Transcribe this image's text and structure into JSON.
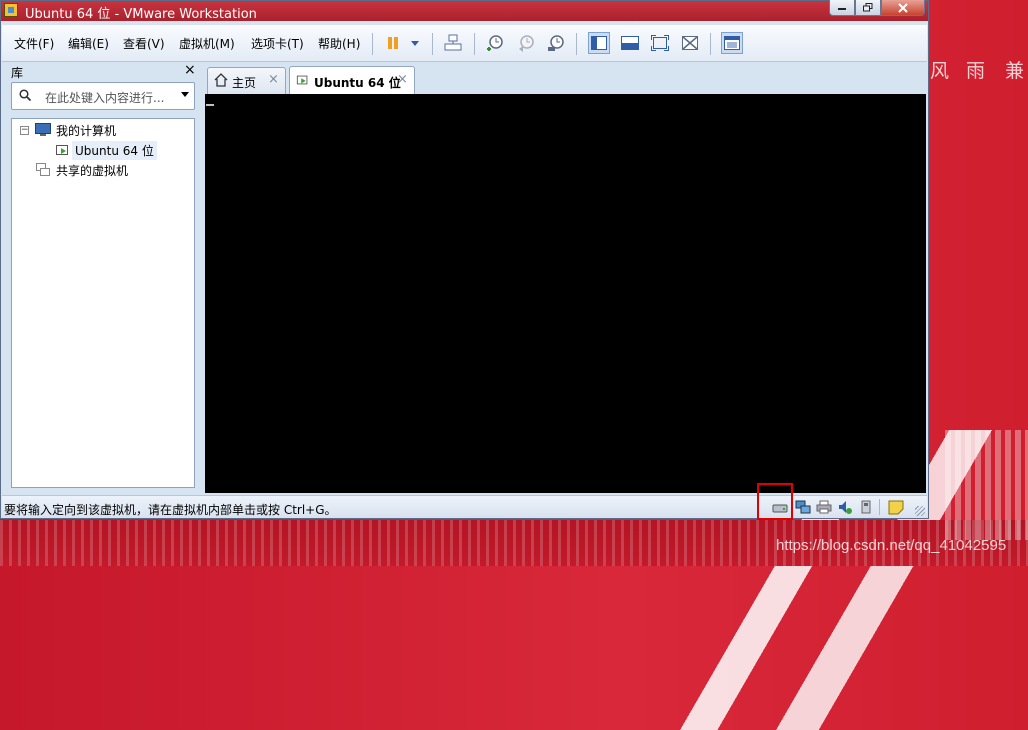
{
  "window": {
    "title": "Ubuntu 64 位 - VMware Workstation"
  },
  "menu": {
    "items": [
      "文件(F)",
      "编辑(E)",
      "查看(V)",
      "虚拟机(M)",
      "选项卡(T)",
      "帮助(H)"
    ]
  },
  "toolbar": {
    "icons": [
      "pause-icon",
      "dropdown-icon",
      "send-keys-icon",
      "snapshot-take-icon",
      "snapshot-revert-icon",
      "snapshot-manager-icon",
      "show-library-icon",
      "console-view-icon",
      "full-screen-icon",
      "unity-icon",
      "thumbnail-icon"
    ]
  },
  "library": {
    "title": "库",
    "close_glyph": "×",
    "search_placeholder": "在此处键入内容进行...",
    "tree": {
      "root": "我的计算机",
      "root_expander": "−",
      "vm": "Ubuntu 64 位",
      "shared": "共享的虚拟机"
    }
  },
  "tabs": [
    {
      "label": "主页",
      "close": "×"
    },
    {
      "label": "Ubuntu 64 位",
      "close": "×"
    }
  ],
  "status": {
    "text": "要将输入定向到该虚拟机，请在虚拟机内部单击或按 Ctrl+G。"
  },
  "desktop": {
    "bg_chars": [
      "风",
      "雨",
      "兼"
    ],
    "watermark": "https://blog.csdn.net/qq_41042595"
  },
  "colors": {
    "highlight": "#e00000",
    "console": "#000000",
    "desktop_red": "#c5182a"
  }
}
